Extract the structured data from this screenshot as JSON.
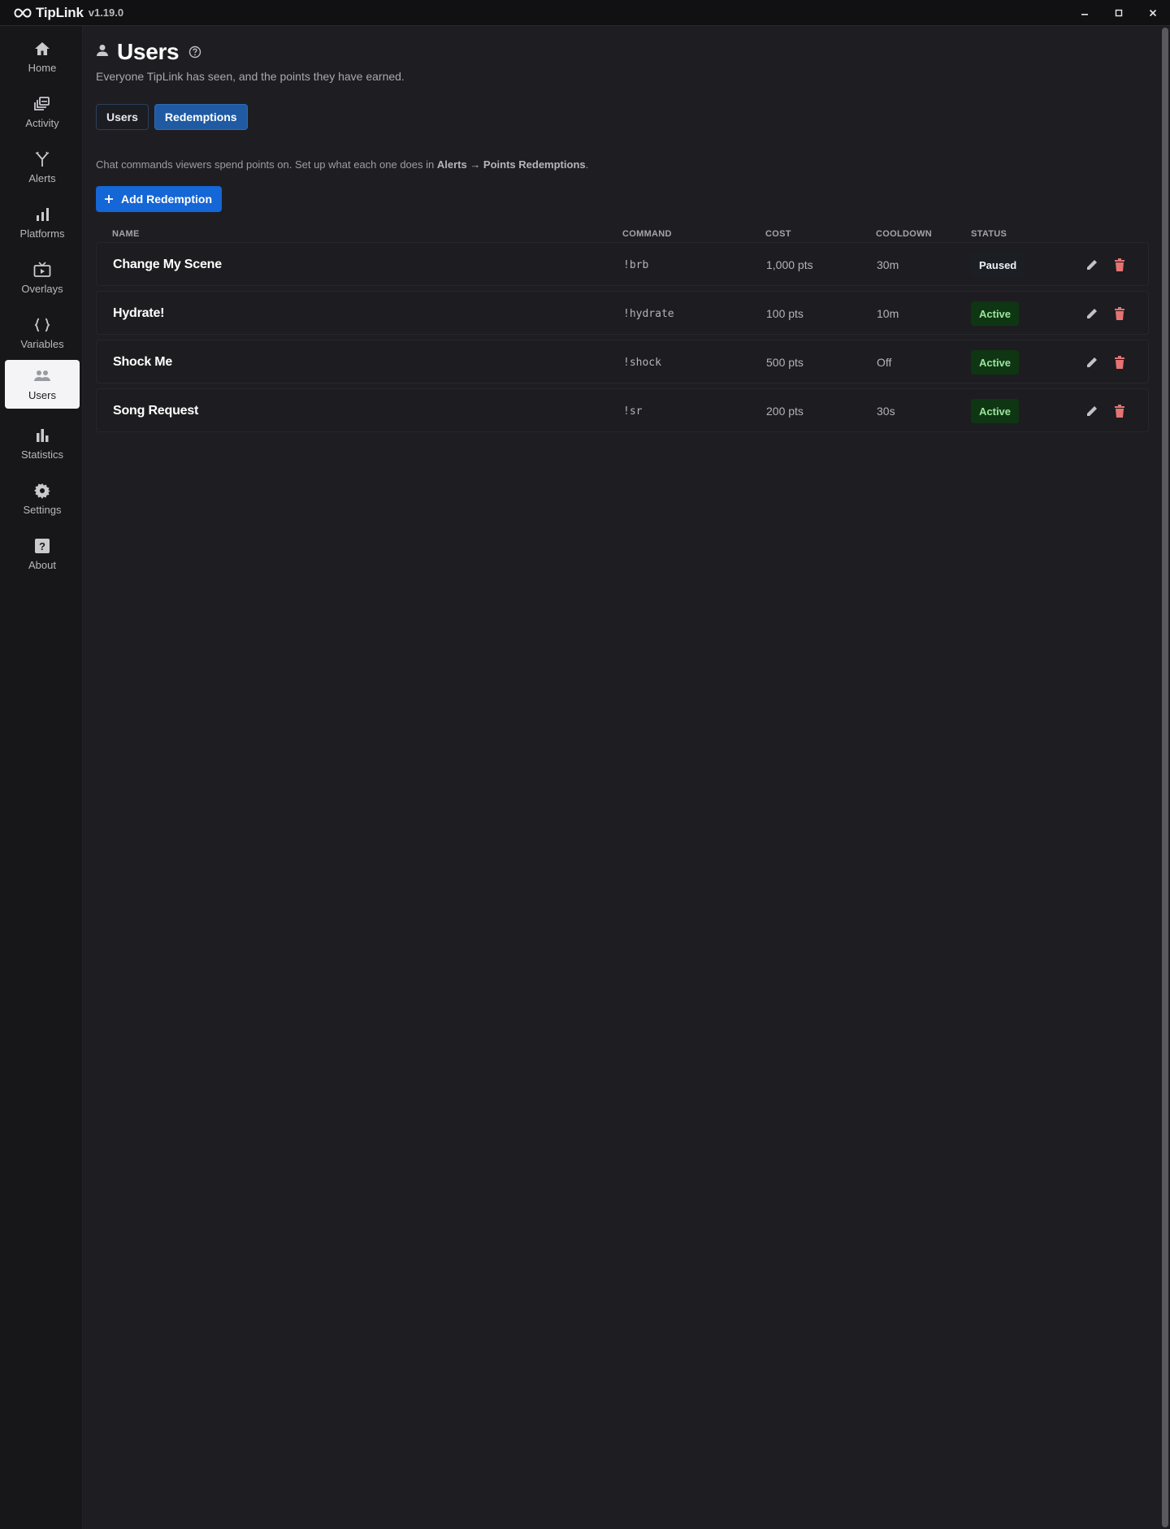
{
  "app": {
    "name": "TipLink",
    "version": "v1.19.0",
    "controls": {
      "minimize": "–",
      "maximize": "□",
      "close": "X"
    }
  },
  "sidebar": {
    "items": [
      {
        "label": "Home",
        "icon": "home-icon"
      },
      {
        "label": "Activity",
        "icon": "activity-icon"
      },
      {
        "label": "Alerts",
        "icon": "alerts-icon"
      },
      {
        "label": "Platforms",
        "icon": "platforms-icon"
      },
      {
        "label": "Overlays",
        "icon": "overlays-icon"
      },
      {
        "label": "Variables",
        "icon": "variables-icon"
      },
      {
        "label": "Users",
        "icon": "users-icon",
        "active": true
      },
      {
        "label": "Statistics",
        "icon": "statistics-icon"
      },
      {
        "label": "Settings",
        "icon": "settings-icon"
      },
      {
        "label": "About",
        "icon": "about-icon"
      }
    ]
  },
  "page": {
    "title": "Users",
    "subtitle": "Everyone TipLink has seen, and the points they have earned.",
    "tabs": [
      {
        "label": "Users",
        "active": false
      },
      {
        "label": "Redemptions",
        "active": true
      }
    ],
    "description": {
      "prefix": "Chat commands viewers spend points on. Set up what each one does in ",
      "link": "Alerts → Points Redemptions",
      "suffix": "."
    },
    "add_button": "Add Redemption"
  },
  "table": {
    "columns": [
      "NAME",
      "COMMAND",
      "COST",
      "COOLDOWN",
      "STATUS"
    ],
    "rows": [
      {
        "name": "Change My Scene",
        "command": "!brb",
        "cost": "1,000 pts",
        "cooldown": "30m",
        "status": "Paused"
      },
      {
        "name": "Hydrate!",
        "command": "!hydrate",
        "cost": "100 pts",
        "cooldown": "10m",
        "status": "Active"
      },
      {
        "name": "Shock Me",
        "command": "!shock",
        "cost": "500 pts",
        "cooldown": "Off",
        "status": "Active"
      },
      {
        "name": "Song Request",
        "command": "!sr",
        "cost": "200 pts",
        "cooldown": "30s",
        "status": "Active"
      }
    ]
  },
  "colors": {
    "accent": "#1566d6",
    "active_badge_bg": "#0f3612",
    "active_badge_text": "#9be59f",
    "delete_icon": "#e57373"
  }
}
